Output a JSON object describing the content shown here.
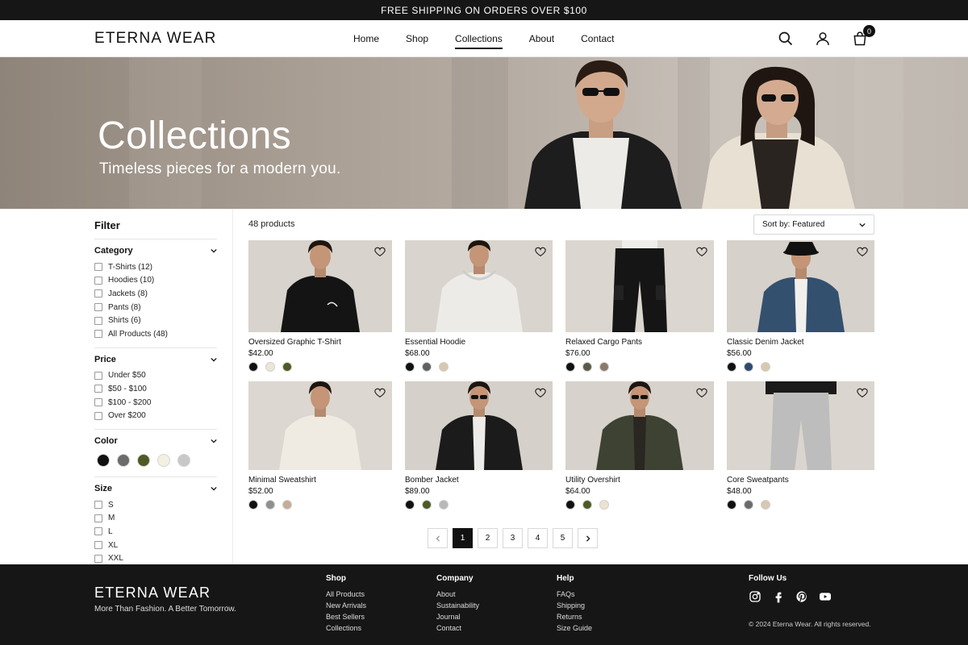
{
  "announcement": "FREE SHIPPING ON ORDERS OVER $100",
  "header": {
    "brand": "ETERNA WEAR",
    "nav": [
      {
        "label": "Home",
        "active": false
      },
      {
        "label": "Shop",
        "active": false
      },
      {
        "label": "Collections",
        "active": true
      },
      {
        "label": "About",
        "active": false
      },
      {
        "label": "Contact",
        "active": false
      }
    ],
    "icons": [
      "search-icon",
      "user-icon",
      "cart-icon"
    ],
    "cart_count": "0"
  },
  "hero": {
    "title": "Collections",
    "subtitle": "Timeless pieces for a modern you."
  },
  "filter": {
    "title": "Filter",
    "category": {
      "label": "Category",
      "options": [
        "T-Shirts (12)",
        "Hoodies (10)",
        "Jackets (8)",
        "Pants (8)",
        "Shirts (6)",
        "All Products (48)"
      ]
    },
    "price": {
      "label": "Price",
      "options": [
        "Under $50",
        "$50 - $100",
        "$100 - $200",
        "Over $200"
      ]
    },
    "color": {
      "label": "Color",
      "swatches": [
        "#111111",
        "#6b6b6b",
        "#4d5a24",
        "#f3efe2",
        "#c8c8c8"
      ]
    },
    "size": {
      "label": "Size",
      "options": [
        "S",
        "M",
        "L",
        "XL",
        "XXL"
      ]
    }
  },
  "toolbar": {
    "count": "48 products",
    "sort_label": "Sort by: Featured"
  },
  "products": [
    {
      "name": "Oversized Graphic T-Shirt",
      "price": "$42.00",
      "colors": [
        "#111111",
        "#ece6d8",
        "#4d5a24"
      ]
    },
    {
      "name": "Essential Hoodie",
      "price": "$68.00",
      "colors": [
        "#111111",
        "#5e6163",
        "#d8c8b0"
      ]
    },
    {
      "name": "Relaxed Cargo Pants",
      "price": "$76.00",
      "colors": [
        "#111111",
        "#5b5a47",
        "#8b7a6a"
      ]
    },
    {
      "name": "Classic Denim Jacket",
      "price": "$56.00",
      "colors": [
        "#111111",
        "#2f4a6c",
        "#d8c8b0"
      ]
    },
    {
      "name": "Minimal Sweatshirt",
      "price": "$52.00",
      "colors": [
        "#111111",
        "#8f8f8f",
        "#c4ad98"
      ]
    },
    {
      "name": "Bomber Jacket",
      "price": "$89.00",
      "colors": [
        "#111111",
        "#4d5a24",
        "#b8b8b8"
      ]
    },
    {
      "name": "Utility Overshirt",
      "price": "$64.00",
      "colors": [
        "#111111",
        "#4d5a24",
        "#ece3d0"
      ]
    },
    {
      "name": "Core Sweatpants",
      "price": "$48.00",
      "colors": [
        "#111111",
        "#6b6b6b",
        "#d8c8b0"
      ]
    }
  ],
  "pagination": {
    "pages": [
      "1",
      "2",
      "3",
      "4",
      "5"
    ],
    "current": "1"
  },
  "footer": {
    "brand": "ETERNA WEAR",
    "tagline": "More Than Fashion. A Better Tomorrow.",
    "columns": [
      {
        "title": "Shop",
        "links": [
          "All Products",
          "New Arrivals",
          "Best Sellers",
          "Collections"
        ]
      },
      {
        "title": "Company",
        "links": [
          "About",
          "Sustainability",
          "Journal",
          "Contact"
        ]
      },
      {
        "title": "Help",
        "links": [
          "FAQs",
          "Shipping",
          "Returns",
          "Size Guide"
        ]
      }
    ],
    "follow_title": "Follow Us",
    "social_icons": [
      "instagram-icon",
      "facebook-icon",
      "pinterest-icon",
      "youtube-icon"
    ],
    "copyright": "© 2024 Eterna Wear. All rights reserved."
  }
}
